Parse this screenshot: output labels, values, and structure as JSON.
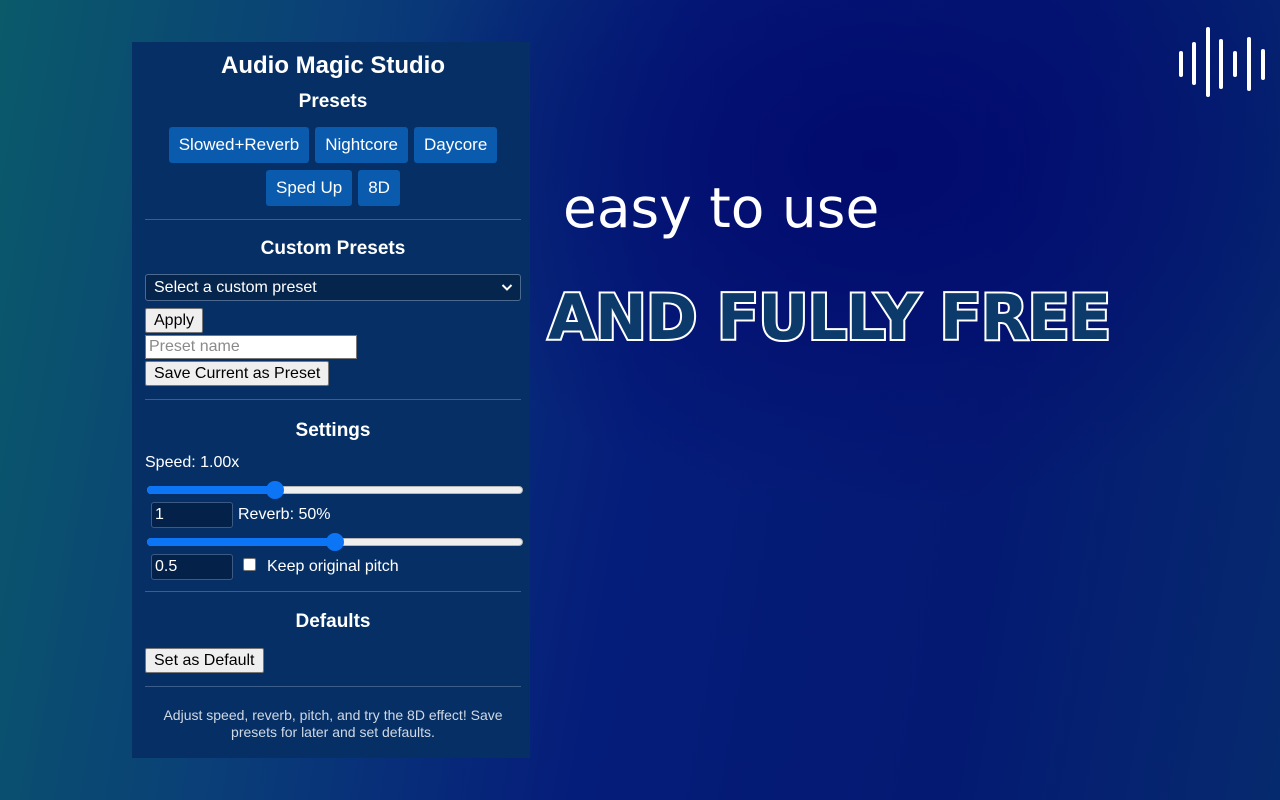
{
  "panel": {
    "title": "Audio Magic Studio",
    "presets": {
      "heading": "Presets",
      "buttons": [
        "Slowed+Reverb",
        "Nightcore",
        "Daycore",
        "Sped Up",
        "8D"
      ]
    },
    "custom_presets": {
      "heading": "Custom Presets",
      "select_value": "Select a custom preset",
      "apply_label": "Apply",
      "name_placeholder": "Preset name",
      "save_label": "Save Current as Preset"
    },
    "settings": {
      "heading": "Settings",
      "speed_label": "Speed: 1.00x",
      "speed_fraction": 0.34,
      "speed_value": "1",
      "reverb_label": "Reverb: 50%",
      "reverb_fraction": 0.5,
      "reverb_value": "0.5",
      "pitch_label": "Keep original pitch",
      "pitch_checked": false
    },
    "defaults": {
      "heading": "Defaults",
      "set_default_label": "Set as Default"
    },
    "footer": "Adjust speed, reverb, pitch, and try the 8D effect! Save presets for later and set defaults."
  },
  "promo": {
    "line1": "easy to use",
    "line2": "AND FULLY FREE",
    "logo_icon": "sound-wave-icon"
  },
  "colors": {
    "panel_bg": "#063065",
    "preset_button": "#0a5aad",
    "slider_accent": "#0b75f5",
    "headline_fill": "#0c3a6a"
  }
}
